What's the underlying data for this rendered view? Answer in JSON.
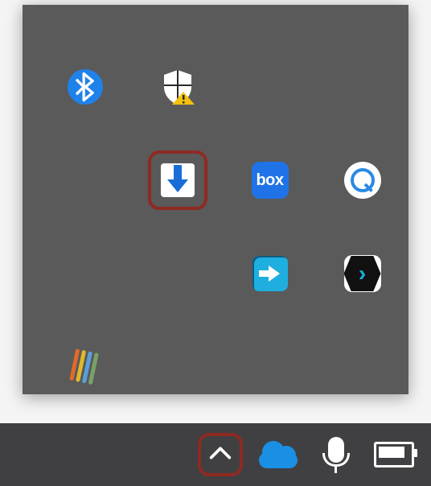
{
  "flyout": {
    "rows": [
      [
        {
          "name": "bluetooth-icon"
        },
        {
          "name": "windows-security-icon"
        },
        null,
        null
      ],
      [
        null,
        {
          "name": "download-tray-icon",
          "highlighted": true
        },
        {
          "name": "box-drive-icon",
          "label": "box"
        },
        {
          "name": "credential-key-icon"
        }
      ],
      [
        null,
        null,
        {
          "name": "teamviewer-icon"
        },
        {
          "name": "sourcetree-icon"
        }
      ],
      [
        {
          "name": "colored-quill-icon"
        },
        null,
        null,
        null
      ]
    ]
  },
  "taskbar": {
    "items": [
      {
        "name": "show-hidden-icons-chevron",
        "highlighted": true
      },
      {
        "name": "onedrive-icon"
      },
      {
        "name": "microphone-icon"
      },
      {
        "name": "battery-icon"
      }
    ]
  }
}
